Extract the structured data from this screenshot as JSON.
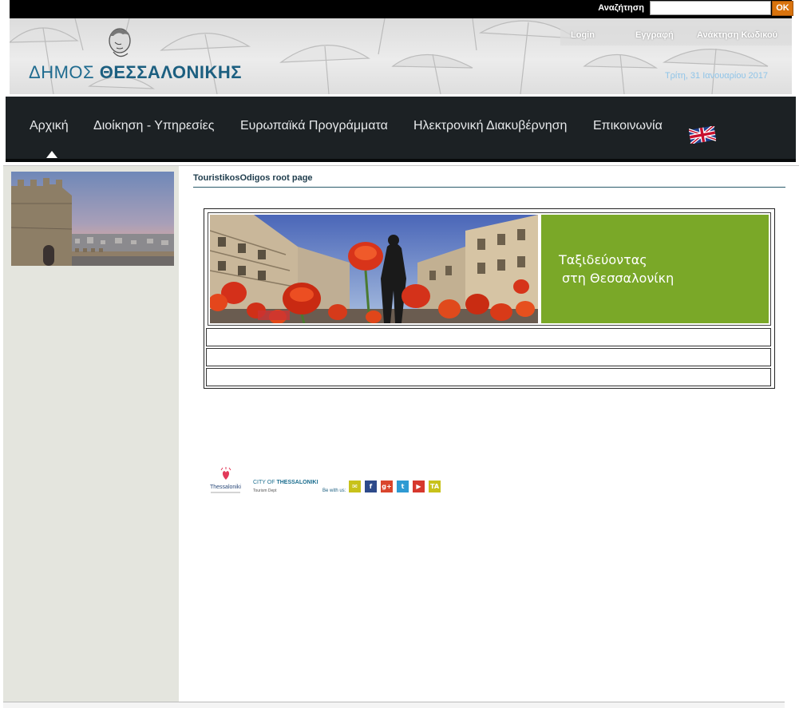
{
  "topbar": {
    "search_label": "Αναζήτηση",
    "search_value": "",
    "ok_label": "OK"
  },
  "header": {
    "logo_light": "ΔΗΜΟΣ ",
    "logo_bold": "ΘΕΣΣΑΛΟΝΙΚΗΣ",
    "login": "Login",
    "register": "Εγγραφή",
    "recover": "Ανάκτηση Κωδικού",
    "date": "Τρίτη, 31 Ιανουαρίου 2017"
  },
  "nav": {
    "items": [
      "Αρχική",
      "Διοίκηση - Υπηρεσίες",
      "Ευρωπαϊκά Προγράμματα",
      "Ηλεκτρονική Διακυβέρνηση",
      "Επικοινωνία"
    ],
    "active_index": 0,
    "flag_icon": "uk-flag-icon"
  },
  "page": {
    "title": "TouristikosOdigos root page"
  },
  "banner": {
    "line1": "Ταξιδεύοντας",
    "line2": "στη Θεσσαλονίκη",
    "accent_color": "#7aa828"
  },
  "footer": {
    "brand_text": "Thessaloniki",
    "city_text_a": "CITY OF ",
    "city_text_b": "THESSALONIKI",
    "tourism_text": "Tourism Dept",
    "be_with_us": "Be with us:",
    "social": [
      {
        "name": "email-icon",
        "color": "#c8c21a",
        "glyph": "✉"
      },
      {
        "name": "facebook-icon",
        "color": "#2d4a8a",
        "glyph": "f"
      },
      {
        "name": "googleplus-icon",
        "color": "#d9452c",
        "glyph": "g+"
      },
      {
        "name": "twitter-icon",
        "color": "#2e9ad3",
        "glyph": "t"
      },
      {
        "name": "youtube-icon",
        "color": "#d6382d",
        "glyph": "▶"
      },
      {
        "name": "tripadvisor-icon",
        "color": "#c8c21a",
        "glyph": "TA"
      }
    ]
  }
}
